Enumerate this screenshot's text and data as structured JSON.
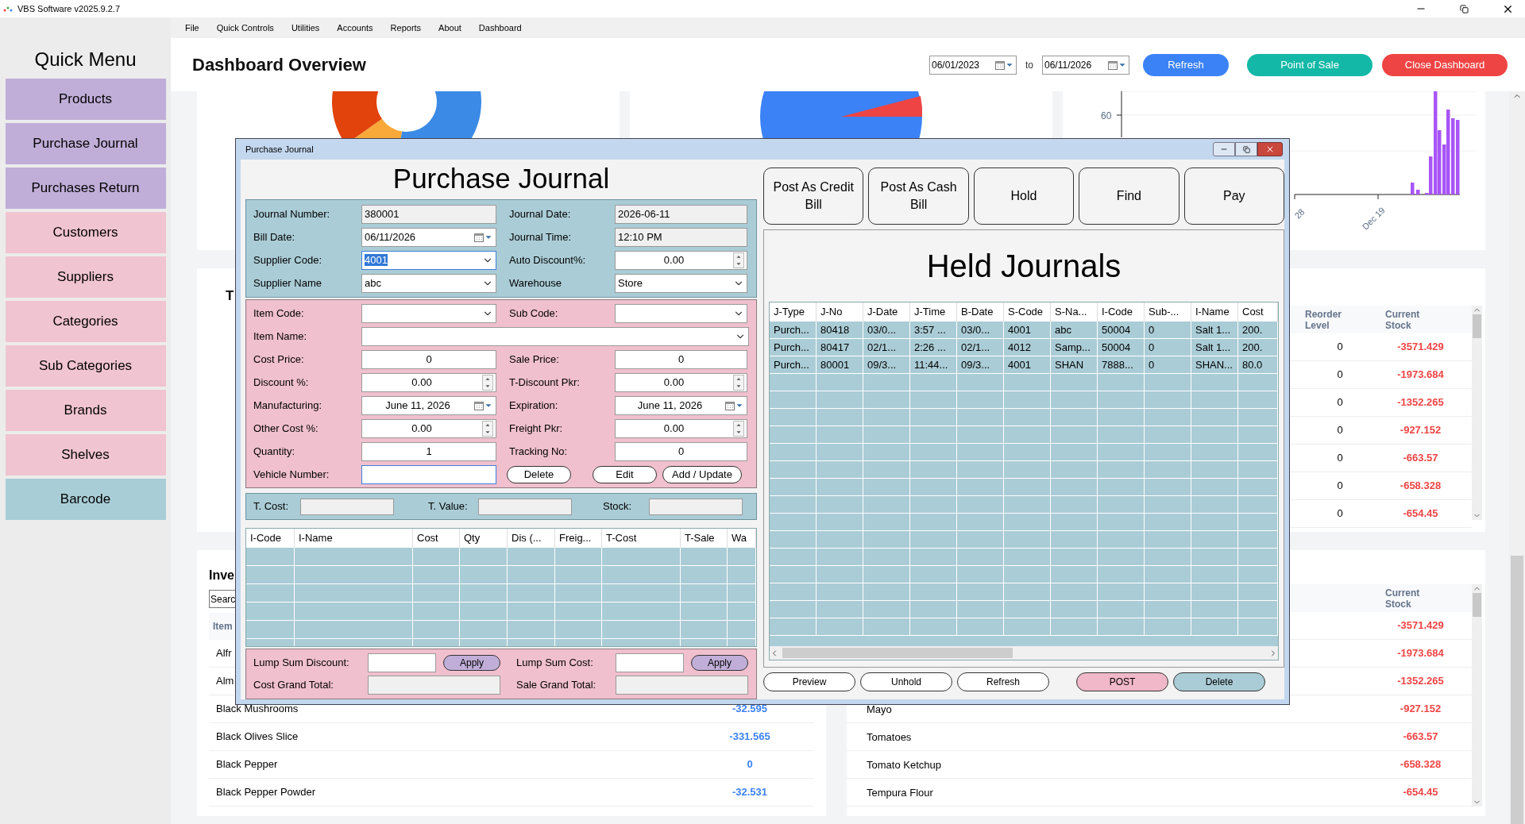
{
  "app_title": "VBS Software v2025.9.2.7",
  "menu": [
    "File",
    "Quick Controls",
    "Utilities",
    "Accounts",
    "Reports",
    "About",
    "Dashboard"
  ],
  "sidebar": {
    "title": "Quick Menu",
    "items": [
      {
        "label": "Products",
        "color": "#c0aed8"
      },
      {
        "label": "Purchase Journal",
        "color": "#c0aed8"
      },
      {
        "label": "Purchases Return",
        "color": "#c0aed8"
      },
      {
        "label": "Customers",
        "color": "#f0c4d0"
      },
      {
        "label": "Suppliers",
        "color": "#f0c4d0"
      },
      {
        "label": "Categories",
        "color": "#f0c4d0"
      },
      {
        "label": "Sub Categories",
        "color": "#f0c4d0"
      },
      {
        "label": "Brands",
        "color": "#f0c4d0"
      },
      {
        "label": "Shelves",
        "color": "#f0c4d0"
      },
      {
        "label": "Barcode",
        "color": "#a9cdd6"
      }
    ]
  },
  "header": {
    "title": "Dashboard Overview",
    "date_from": "06/01/2023",
    "to_label": "to",
    "date_to": "06/11/2026",
    "buttons": [
      {
        "label": "Refresh",
        "color": "#3b82f6"
      },
      {
        "label": "Point of Sale",
        "color": "#14b8a6"
      },
      {
        "label": "Close Dashboard",
        "color": "#ef4444"
      }
    ]
  },
  "bar_chart_labels": {
    "y_ticks": [
      "60"
    ],
    "x_ticks": [
      "28",
      "Dec 19"
    ]
  },
  "reorder_card": {
    "heading": "T",
    "columns": [
      "Reorder Level",
      "Current Stock"
    ],
    "rows": [
      {
        "reorder": "0",
        "stock": "-3571.429"
      },
      {
        "reorder": "0",
        "stock": "-1973.684"
      },
      {
        "reorder": "0",
        "stock": "-1352.265"
      },
      {
        "reorder": "0",
        "stock": "-927.152"
      },
      {
        "reorder": "0",
        "stock": "-663.57"
      },
      {
        "reorder": "0",
        "stock": "-658.328"
      },
      {
        "reorder": "0",
        "stock": "-654.45"
      }
    ]
  },
  "inventory_card": {
    "heading": "Inve",
    "search_placeholder": "Searc",
    "column": "Item",
    "rows": [
      {
        "name": "Alfr"
      },
      {
        "name": "Alm"
      },
      {
        "name": "Black Mushrooms",
        "value": "-32.595"
      },
      {
        "name": "Black Olives Slice",
        "value": "-331.565"
      },
      {
        "name": "Black Pepper",
        "value": "0"
      },
      {
        "name": "Black Pepper Powder",
        "value": "-32.531"
      }
    ]
  },
  "stock_card": {
    "column": "Current Stock",
    "rows": [
      {
        "stock": "-3571.429"
      },
      {
        "stock": "-1973.684"
      },
      {
        "stock": "-1352.265"
      },
      {
        "name": "Mayo",
        "stock": "-927.152"
      },
      {
        "name": "Tomatoes",
        "stock": "-663.57"
      },
      {
        "name": "Tomato Ketchup",
        "stock": "-658.328"
      },
      {
        "name": "Tempura Flour",
        "stock": "-654.45"
      }
    ]
  },
  "dialog": {
    "title": "Purchase Journal",
    "heading": "Purchase Journal",
    "header_rows": [
      {
        "left": {
          "label": "Journal Number:",
          "kind": "readonly",
          "value": "380001",
          "focused": false
        },
        "right": {
          "label": "Journal Date:",
          "kind": "readonly",
          "value": "2026-06-11",
          "focused": false
        }
      },
      {
        "left": {
          "label": "Bill Date:",
          "kind": "date",
          "value": "06/11/2026",
          "focused": false
        },
        "right": {
          "label": "Journal Time:",
          "kind": "readonly",
          "value": "12:10 PM",
          "focused": false
        }
      },
      {
        "left": {
          "label": "Supplier Code:",
          "kind": "combo",
          "value": "4001",
          "focused": true
        },
        "right": {
          "label": "Auto Discount%:",
          "kind": "spin",
          "value": "0.00",
          "focused": false
        }
      },
      {
        "left": {
          "label": "Supplier Name",
          "kind": "combo",
          "value": "abc",
          "focused": false
        },
        "right": {
          "label": "Warehouse",
          "kind": "combo",
          "value": "Store",
          "focused": false
        }
      }
    ],
    "item_rows": [
      {
        "left": {
          "label": "Item Code:",
          "kind": "combo",
          "focused": false
        },
        "right": {
          "label": "Sub Code:",
          "kind": "combo",
          "focused": false
        }
      },
      {
        "left": {
          "label": "Item Name:",
          "kind": "combo",
          "focused": false
        }
      },
      {
        "left": {
          "label": "Cost Price:",
          "kind": "number",
          "value": "0",
          "focused": false
        },
        "right": {
          "label": "Sale Price:",
          "kind": "number",
          "value": "0",
          "focused": false
        }
      },
      {
        "left": {
          "label": "Discount %:",
          "kind": "spin",
          "value": "0.00",
          "focused": false
        },
        "right": {
          "label": "T-Discount Pkr:",
          "kind": "spin",
          "value": "0.00",
          "focused": false
        }
      },
      {
        "left": {
          "label": "Manufacturing:",
          "kind": "longdate",
          "value": "June 11, 2026",
          "focused": false
        },
        "right": {
          "label": "Expiration:",
          "kind": "longdate",
          "value": "June 11, 2026",
          "focused": false
        }
      },
      {
        "left": {
          "label": "Other Cost %:",
          "kind": "spin",
          "value": "0.00",
          "focused": false
        },
        "right": {
          "label": "Freight Pkr:",
          "kind": "spin",
          "value": "0.00",
          "focused": false
        }
      },
      {
        "left": {
          "label": "Quantity:",
          "kind": "number",
          "value": "1",
          "focused": false
        },
        "right": {
          "label": "Tracking No:",
          "kind": "number",
          "value": "0",
          "focused": false
        }
      },
      {
        "left": {
          "label": "Vehicle Number:",
          "kind": "text",
          "focused": true
        },
        "buttons": [
          "Delete",
          "Edit",
          "Add / Update"
        ]
      }
    ],
    "totals": [
      {
        "label": "T. Cost:"
      },
      {
        "label": "T. Value:"
      },
      {
        "label": "Stock:"
      }
    ],
    "lines_table": {
      "columns": [
        "I-Code",
        "I-Name",
        "Cost",
        "Qty",
        "Dis (...",
        "Freig...",
        "T-Cost",
        "T-Sale",
        "Wa"
      ]
    },
    "lump_rows": [
      {
        "left": {
          "label": "Lump Sum Discount:",
          "kind": "text",
          "focused": false,
          "button": "Apply"
        },
        "right": {
          "label": "Lump Sum Cost:",
          "kind": "text",
          "focused": false,
          "button": "Apply"
        }
      },
      {
        "left": {
          "label": "Cost Grand Total:",
          "kind": "readonly",
          "focused": false
        },
        "right": {
          "label": "Sale Grand Total:",
          "kind": "readonly",
          "focused": false
        }
      }
    ],
    "actions": [
      "Post As Credit Bill",
      "Post As Cash Bill",
      "Hold",
      "Find",
      "Pay"
    ],
    "held": {
      "heading": "Held Journals",
      "columns": [
        "J-Type",
        "J-No",
        "J-Date",
        "J-Time",
        "B-Date",
        "S-Code",
        "S-Na...",
        "I-Code",
        "Sub-...",
        "I-Name",
        "Cost"
      ],
      "rows": [
        [
          "Purch...",
          "80418",
          "03/0...",
          "3:57 ...",
          "03/0...",
          "4001",
          "abc",
          "50004",
          "0",
          "Salt 1...",
          "200."
        ],
        [
          "Purch...",
          "80417",
          "02/1...",
          "2:26 ...",
          "02/1...",
          "4012",
          "Samp...",
          "50004",
          "0",
          "Salt 1...",
          "200."
        ],
        [
          "Purch...",
          "80001",
          "09/3...",
          "11:44...",
          "09/3...",
          "4001",
          "SHAN",
          "7888...",
          "0",
          "SHAN...",
          "80.0"
        ]
      ]
    },
    "held_buttons": [
      {
        "label": "Preview",
        "kind": "plain"
      },
      {
        "label": "Unhold",
        "kind": "plain"
      },
      {
        "label": "Refresh",
        "kind": "plain"
      },
      {
        "label": "POST",
        "kind": "primary"
      },
      {
        "label": "Delete",
        "kind": "secondary"
      }
    ]
  }
}
